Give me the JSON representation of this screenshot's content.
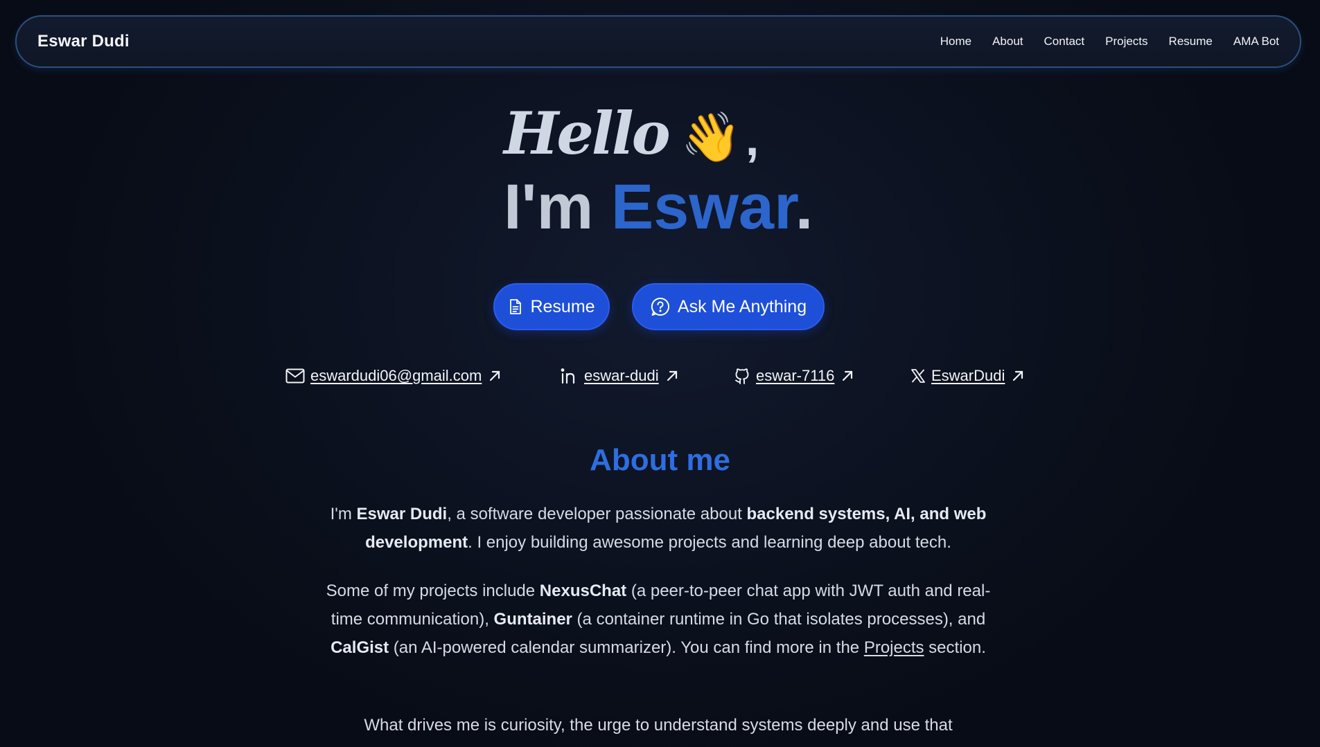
{
  "navbar": {
    "brand": "Eswar Dudi",
    "links": [
      "Home",
      "About",
      "Contact",
      "Projects",
      "Resume",
      "AMA Bot"
    ]
  },
  "hero": {
    "hello": "Hello",
    "wave_emoji": "👋",
    "comma": ",",
    "im_prefix": "I'm ",
    "name": "Eswar",
    "dot": "."
  },
  "buttons": {
    "resume": {
      "label": "Resume",
      "icon": "document-icon"
    },
    "ama": {
      "label": "Ask Me Anything",
      "icon": "question-circle-icon"
    }
  },
  "contacts": {
    "email": {
      "text": "eswardudi06@gmail.com",
      "icon": "mail-icon"
    },
    "linkedin": {
      "text": "eswar-dudi",
      "icon": "linkedin-icon"
    },
    "github": {
      "text": "eswar-7116",
      "icon": "github-icon"
    },
    "x": {
      "text": "EswarDudi",
      "icon": "x-icon"
    }
  },
  "about": {
    "title": "About me",
    "p1": {
      "t1": "I'm ",
      "b1": "Eswar Dudi",
      "t2": ", a software developer passionate about ",
      "b2": "backend systems, AI, and web development",
      "t3": ". I enjoy building awesome projects and learning deep about tech."
    },
    "p2": {
      "t1": "Some of my projects include ",
      "b1": "NexusChat",
      "t2": " (a peer-to-peer chat app with JWT auth and real-time communication), ",
      "b2": "Guntainer",
      "t3": " (a container runtime in Go that isolates processes), and ",
      "b3": "CalGist",
      "t4": " (an AI-powered calendar summarizer). You can find more in the ",
      "link": "Projects",
      "t5": " section."
    },
    "p3": {
      "t1": "What drives me is curiosity, the urge to understand systems deeply and use that"
    }
  },
  "colors": {
    "accent": "#2c65cc",
    "button": "#1d4fd8",
    "nav_border": "#2c4f7e",
    "background": "#0d1322"
  }
}
